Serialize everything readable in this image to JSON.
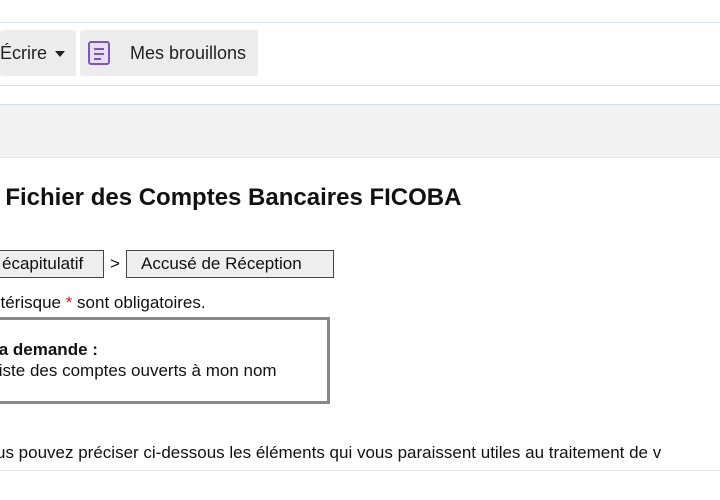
{
  "toolbar": {
    "compose_label": "Écrire",
    "drafts_label": "Mes brouillons"
  },
  "page": {
    "title": "u Fichier des Comptes Bancaires FICOBA"
  },
  "steps": [
    {
      "label": "écapitulatif"
    },
    {
      "label": "Accusé de Réception"
    }
  ],
  "step_separator": ">",
  "required_note": {
    "before": "stérisque ",
    "star": "*",
    "after": " sont obligatoires."
  },
  "request": {
    "title": "la demande :",
    "value": "liste des comptes ouverts à mon nom"
  },
  "hint": "us pouvez préciser ci-dessous les éléments qui vous paraissent utiles au traitement de v",
  "colors": {
    "required_star": "#d9161f",
    "drafts_icon": "#7a57b8"
  },
  "icons": {
    "compose_dropdown": "caret-down-icon",
    "drafts": "drafts-document-icon"
  }
}
